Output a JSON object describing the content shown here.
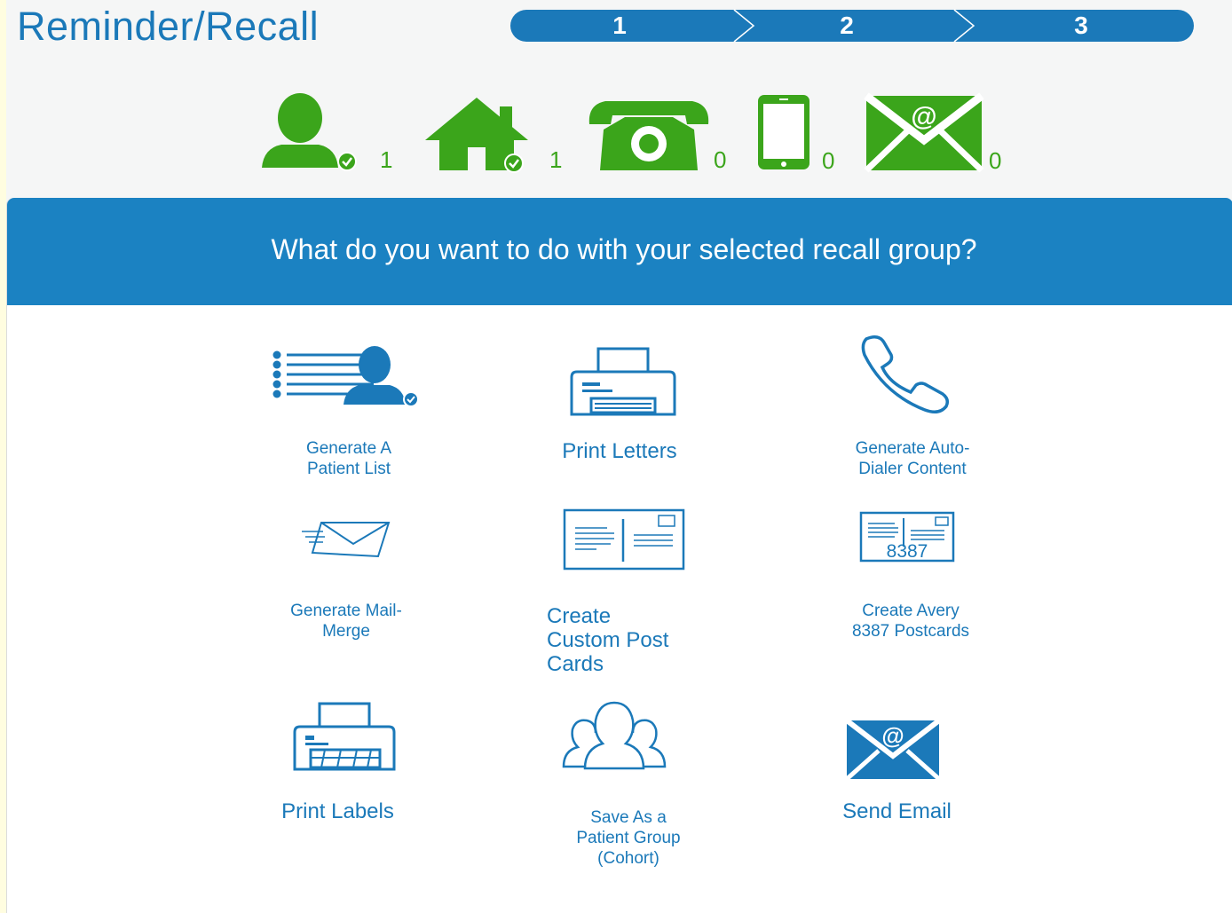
{
  "header": {
    "title": "Reminder/Recall",
    "steps": [
      "1",
      "2",
      "3"
    ]
  },
  "contact_summary": [
    {
      "icon": "person-icon",
      "count": "1"
    },
    {
      "icon": "home-icon",
      "count": "1"
    },
    {
      "icon": "telephone-icon",
      "count": "0"
    },
    {
      "icon": "mobile-phone-icon",
      "count": "0"
    },
    {
      "icon": "email-envelope-icon",
      "count": "0"
    }
  ],
  "panel": {
    "question": "What do you want to do with your selected recall group?"
  },
  "actions": {
    "patient_list": {
      "line1": "Generate A",
      "line2": "Patient List",
      "icon": "patient-list-icon"
    },
    "print_letters": {
      "line1": "Print Letters",
      "icon": "printer-icon"
    },
    "auto_dialer": {
      "line1": "Generate Auto-",
      "line2": "Dialer Content",
      "icon": "phone-handset-icon"
    },
    "mail_merge": {
      "line1": "Generate Mail-",
      "line2": "Merge",
      "icon": "flying-envelope-icon"
    },
    "custom_post_cards": {
      "line1": "Create",
      "line2": "Custom Post",
      "line3": "Cards",
      "icon": "postcard-icon"
    },
    "avery_postcards": {
      "line1": "Create Avery",
      "line2": "8387 Postcards",
      "icon": "avery-postcard-icon",
      "icon_text": "8387"
    },
    "print_labels": {
      "line1": "Print Labels",
      "icon": "label-printer-icon"
    },
    "save_group": {
      "line1": "Save As a",
      "line2": "Patient Group",
      "line3": "(Cohort)",
      "icon": "patient-group-icon"
    },
    "send_email": {
      "line1": "Send Email",
      "icon": "email-icon"
    }
  },
  "colors": {
    "brand_blue": "#1b79b9",
    "banner_blue": "#1b82c2",
    "status_green": "#3ba51b"
  }
}
